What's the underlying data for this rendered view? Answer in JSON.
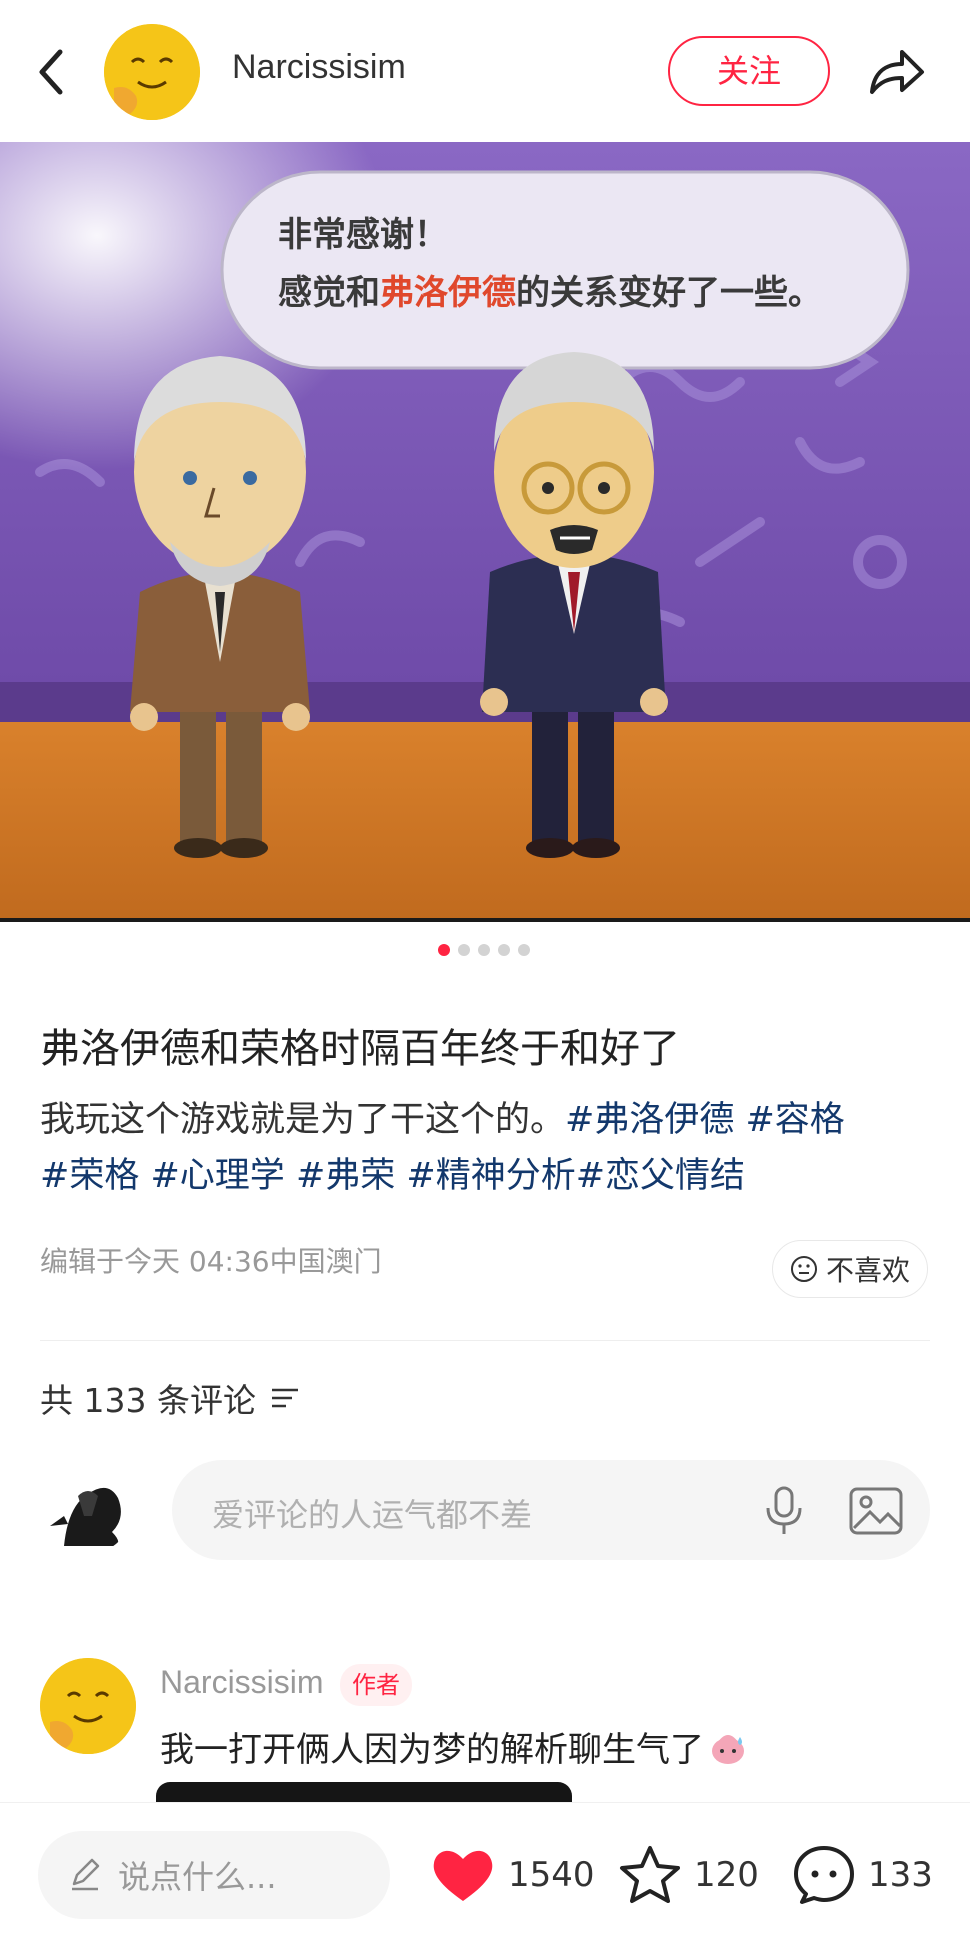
{
  "header": {
    "author_name": "Narcissisim",
    "follow_label": "关注"
  },
  "hero": {
    "bubble_line1": "非常感谢！",
    "bubble_line2_prefix": "感觉和",
    "bubble_line2_highlight": "弗洛伊德",
    "bubble_line2_suffix": "的关系变好了一些。",
    "pagination_total": 5,
    "pagination_active": 1
  },
  "post": {
    "title": "弗洛伊德和荣格时隔百年终于和好了",
    "body_text": "我玩这个游戏就是为了干这个的。",
    "tags": [
      "#弗洛伊德",
      "#容格",
      "#荣格",
      "#心理学",
      "#弗荣",
      "#精神分析",
      "#恋父情结"
    ],
    "meta": "编辑于今天 04:36中国澳门",
    "dislike_label": "不喜欢"
  },
  "comments": {
    "count_label": "共 133 条评论",
    "input_placeholder": "爱评论的人运气都不差",
    "items": [
      {
        "author": "Narcissisim",
        "badge": "作者",
        "text": "我一打开俩人因为梦的解析聊生气了"
      }
    ]
  },
  "bottom_bar": {
    "say_placeholder": "说点什么...",
    "likes": "1540",
    "stars": "120",
    "comments": "133"
  },
  "colors": {
    "accent": "#ff2442",
    "tag": "#13386c",
    "avatar_yellow": "#f5c518"
  }
}
